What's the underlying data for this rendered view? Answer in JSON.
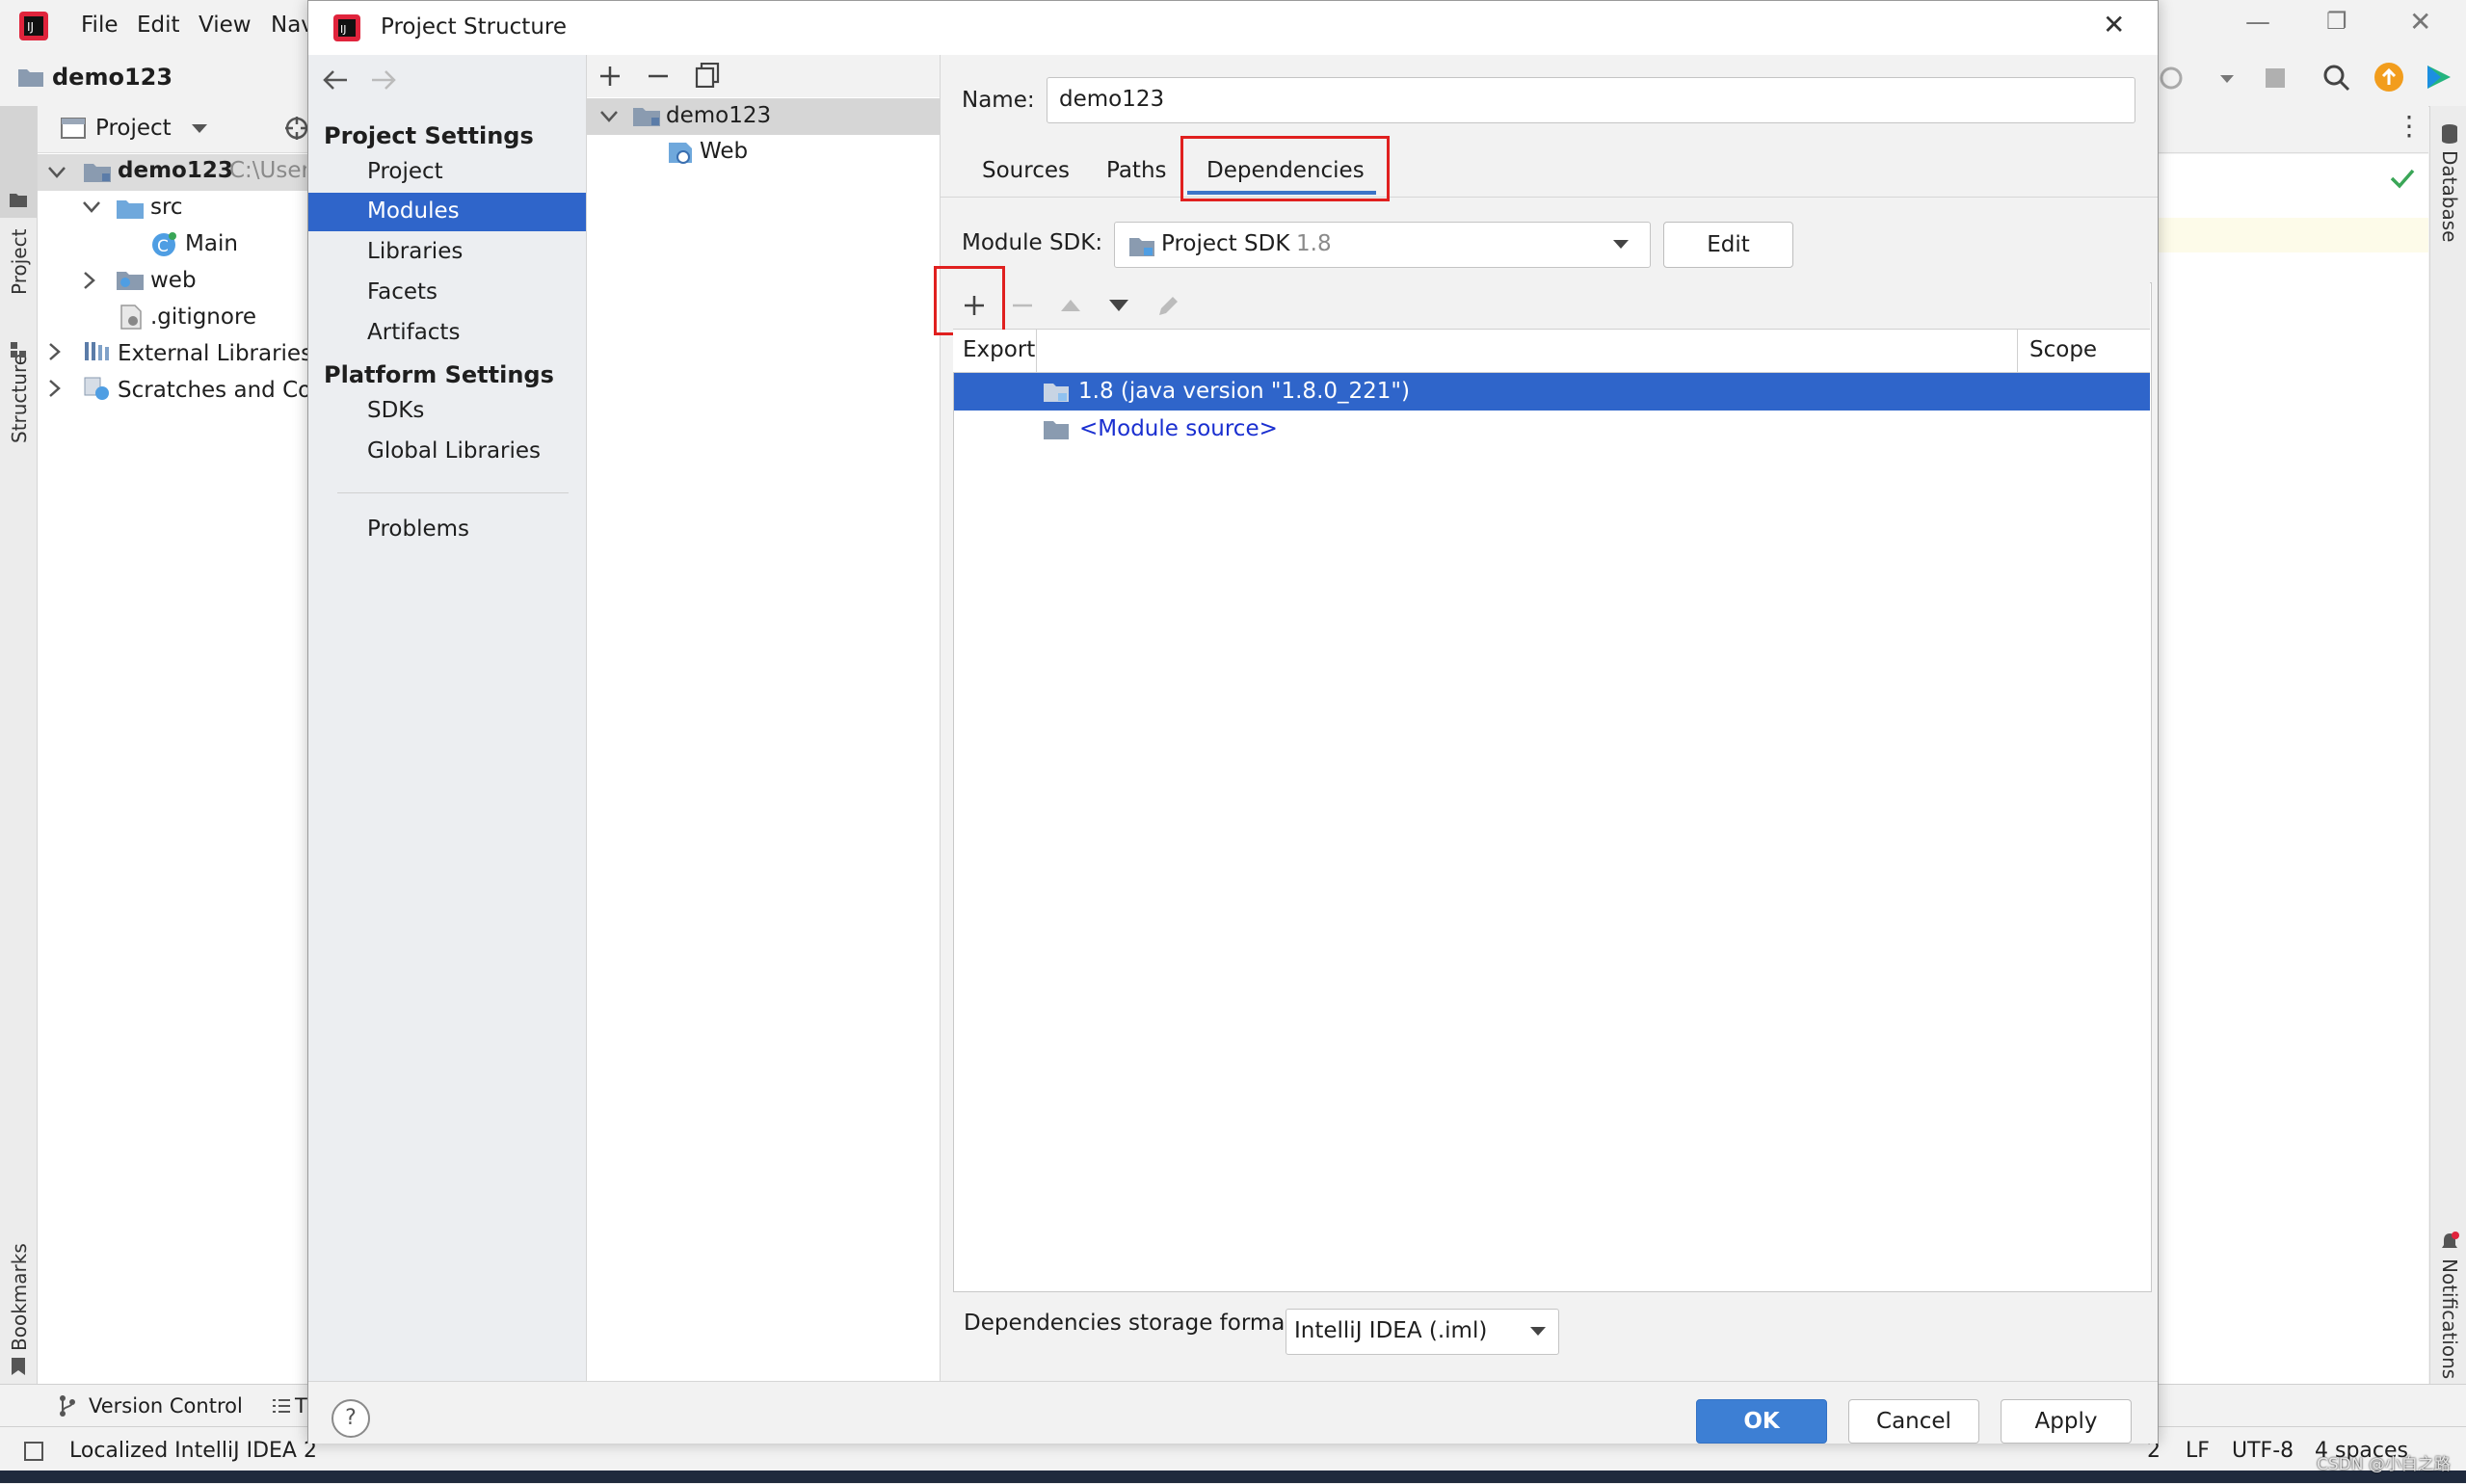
{
  "ide": {
    "menu": [
      "File",
      "Edit",
      "View",
      "Nav"
    ],
    "project_name": "demo123",
    "project_view_label": "Project",
    "tree": {
      "root": "demo123",
      "root_path": "C:\\Users",
      "src": "src",
      "main": "Main",
      "web": "web",
      "gitignore": ".gitignore",
      "external_libraries": "External Libraries",
      "scratches": "Scratches and Con"
    },
    "left_stripe": {
      "project": "Project",
      "structure": "Structure",
      "bookmarks": "Bookmarks"
    },
    "right_stripe": {
      "database": "Database",
      "notifications": "Notifications"
    },
    "bottom_tabs": {
      "version_control": "Version Control",
      "todo": "T"
    },
    "status_text": "Localized IntelliJ IDEA 2",
    "status_right": {
      "pos": "2",
      "line_sep": "LF",
      "encoding": "UTF-8",
      "indent": "4 spaces"
    },
    "watermark": "CSDN @小白之路"
  },
  "dialog": {
    "title": "Project Structure",
    "sidebar": {
      "project_settings": "Project Settings",
      "items": [
        "Project",
        "Modules",
        "Libraries",
        "Facets",
        "Artifacts"
      ],
      "selected": "Modules",
      "platform_settings": "Platform Settings",
      "platform_items": [
        "SDKs",
        "Global Libraries"
      ],
      "problems": "Problems"
    },
    "module_tree": {
      "module": "demo123",
      "facet": "Web"
    },
    "name_label": "Name:",
    "name_value": "demo123",
    "tabs": [
      "Sources",
      "Paths",
      "Dependencies"
    ],
    "active_tab": "Dependencies",
    "sdk_label": "Module SDK:",
    "sdk_value": "Project SDK",
    "sdk_version": "1.8",
    "edit_button": "Edit",
    "table": {
      "col_export": "Export",
      "col_scope": "Scope",
      "rows": [
        "1.8 (java version \"1.8.0_221\")",
        "<Module source>"
      ]
    },
    "storage_label": "Dependencies storage format:",
    "storage_value": "IntelliJ IDEA (.iml)",
    "buttons": {
      "ok": "OK",
      "cancel": "Cancel",
      "apply": "Apply"
    },
    "help": "?"
  },
  "colors": {
    "selection": "#2f65ca",
    "highlight_box": "#e0201f",
    "link": "#1a2fd0",
    "primary_button": "#3d7fd4"
  }
}
